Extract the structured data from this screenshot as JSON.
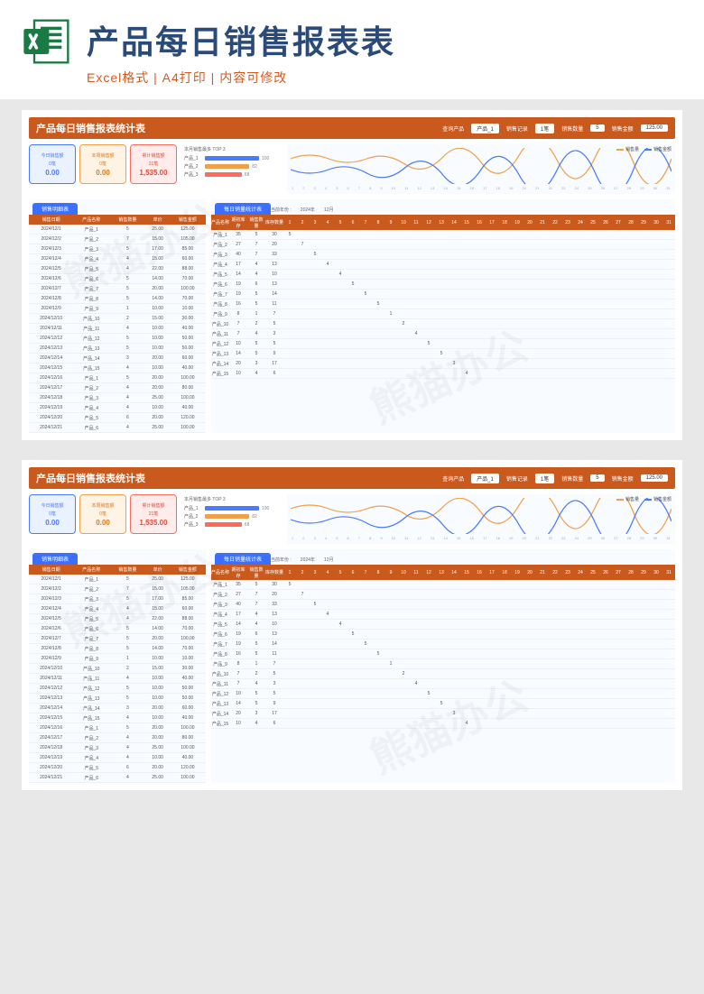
{
  "header": {
    "title": "产品每日销售报表表",
    "subtitle": "Excel格式 | A4打印 | 内容可修改"
  },
  "watermark": "熊猫办公",
  "sheet": {
    "title": "产品每日销售报表统计表",
    "head_fields": {
      "p_label": "查询产品",
      "p_value": "产品_1",
      "r_label": "销售记录",
      "r_value": "1笔",
      "q_label": "销售数量",
      "q_value": "5",
      "a_label": "销售金额",
      "a_value": "125.00"
    },
    "kpi": [
      {
        "label": "今日销售额",
        "sub": "0笔",
        "value": "0.00"
      },
      {
        "label": "本周销售额",
        "sub": "0笔",
        "value": "0.00"
      },
      {
        "label": "累计销售额",
        "sub": "21笔",
        "value": "1,535.00"
      }
    ],
    "chart_data": {
      "type": "bar",
      "title": "本月销售最多 TOP 3",
      "categories": [
        "产品_1",
        "产品_2",
        "产品_3"
      ],
      "values": [
        100,
        82,
        68
      ],
      "colors": [
        "#4a7bff",
        "#f0a04a",
        "#ff6a5a"
      ]
    },
    "line_legend": {
      "a": "销售量",
      "b": "销售金额"
    },
    "line_days": [
      1,
      2,
      3,
      4,
      5,
      6,
      7,
      8,
      9,
      10,
      11,
      12,
      13,
      14,
      15,
      16,
      17,
      18,
      19,
      20,
      21,
      22,
      23,
      24,
      25,
      26,
      27,
      28,
      29,
      30,
      31
    ],
    "period": {
      "label_year": "当前年份 :",
      "year": "2024年",
      "month": "12月"
    },
    "detail": {
      "tab": "销售明细表",
      "columns": [
        "销售日期",
        "产品名称",
        "销售数量",
        "单价",
        "销售金额"
      ],
      "rows": [
        [
          "2024/12/1",
          "产品_1",
          "5",
          "25.00",
          "125.00"
        ],
        [
          "2024/12/2",
          "产品_2",
          "7",
          "15.00",
          "105.00"
        ],
        [
          "2024/12/3",
          "产品_3",
          "5",
          "17.00",
          "85.00"
        ],
        [
          "2024/12/4",
          "产品_4",
          "4",
          "15.00",
          "60.00"
        ],
        [
          "2024/12/5",
          "产品_5",
          "4",
          "22.00",
          "88.00"
        ],
        [
          "2024/12/6",
          "产品_6",
          "5",
          "14.00",
          "70.00"
        ],
        [
          "2024/12/7",
          "产品_7",
          "5",
          "20.00",
          "100.00"
        ],
        [
          "2024/12/8",
          "产品_8",
          "5",
          "14.00",
          "70.00"
        ],
        [
          "2024/12/9",
          "产品_9",
          "1",
          "10.00",
          "10.00"
        ],
        [
          "2024/12/10",
          "产品_10",
          "2",
          "15.00",
          "30.00"
        ],
        [
          "2024/12/11",
          "产品_11",
          "4",
          "10.00",
          "40.00"
        ],
        [
          "2024/12/12",
          "产品_12",
          "5",
          "10.00",
          "50.00"
        ],
        [
          "2024/12/13",
          "产品_13",
          "5",
          "10.00",
          "50.00"
        ],
        [
          "2024/12/14",
          "产品_14",
          "3",
          "20.00",
          "60.00"
        ],
        [
          "2024/12/15",
          "产品_15",
          "4",
          "10.00",
          "40.00"
        ],
        [
          "2024/12/16",
          "产品_1",
          "5",
          "20.00",
          "100.00"
        ],
        [
          "2024/12/17",
          "产品_2",
          "4",
          "20.00",
          "80.00"
        ],
        [
          "2024/12/18",
          "产品_3",
          "4",
          "25.00",
          "100.00"
        ],
        [
          "2024/12/19",
          "产品_4",
          "4",
          "10.00",
          "40.00"
        ],
        [
          "2024/12/20",
          "产品_5",
          "6",
          "20.00",
          "120.00"
        ],
        [
          "2024/12/21",
          "产品_6",
          "4",
          "25.00",
          "100.00"
        ]
      ]
    },
    "daily": {
      "tab": "每日销量统计表",
      "columns": [
        "产品名称",
        "期初库存",
        "销售数量",
        "库存数量"
      ],
      "days": [
        "1",
        "2",
        "3",
        "4",
        "5",
        "6",
        "7",
        "8",
        "9",
        "10",
        "11",
        "12",
        "13",
        "14",
        "15",
        "16",
        "17",
        "18",
        "19",
        "20",
        "21",
        "22",
        "23",
        "24",
        "25",
        "26",
        "27",
        "28",
        "29",
        "30",
        "31"
      ],
      "rows": [
        {
          "p": "产品_1",
          "s": "35",
          "q": "5",
          "r": "30",
          "m": {
            "1": "5"
          }
        },
        {
          "p": "产品_2",
          "s": "27",
          "q": "7",
          "r": "20",
          "m": {
            "2": "7"
          }
        },
        {
          "p": "产品_3",
          "s": "40",
          "q": "7",
          "r": "33",
          "m": {
            "3": "5"
          }
        },
        {
          "p": "产品_4",
          "s": "17",
          "q": "4",
          "r": "13",
          "m": {
            "4": "4"
          }
        },
        {
          "p": "产品_5",
          "s": "14",
          "q": "4",
          "r": "10",
          "m": {
            "5": "4"
          }
        },
        {
          "p": "产品_6",
          "s": "19",
          "q": "6",
          "r": "13",
          "m": {
            "6": "5"
          }
        },
        {
          "p": "产品_7",
          "s": "19",
          "q": "5",
          "r": "14",
          "m": {
            "7": "5"
          }
        },
        {
          "p": "产品_8",
          "s": "16",
          "q": "5",
          "r": "11",
          "m": {
            "8": "5"
          }
        },
        {
          "p": "产品_9",
          "s": "8",
          "q": "1",
          "r": "7",
          "m": {
            "9": "1"
          }
        },
        {
          "p": "产品_10",
          "s": "7",
          "q": "2",
          "r": "5",
          "m": {
            "10": "2"
          }
        },
        {
          "p": "产品_11",
          "s": "7",
          "q": "4",
          "r": "3",
          "m": {
            "11": "4"
          }
        },
        {
          "p": "产品_12",
          "s": "10",
          "q": "5",
          "r": "5",
          "m": {
            "12": "5"
          }
        },
        {
          "p": "产品_13",
          "s": "14",
          "q": "5",
          "r": "9",
          "m": {
            "13": "5"
          }
        },
        {
          "p": "产品_14",
          "s": "20",
          "q": "3",
          "r": "17",
          "m": {
            "14": "3"
          }
        },
        {
          "p": "产品_15",
          "s": "10",
          "q": "4",
          "r": "6",
          "m": {
            "15": "4"
          }
        }
      ]
    }
  }
}
